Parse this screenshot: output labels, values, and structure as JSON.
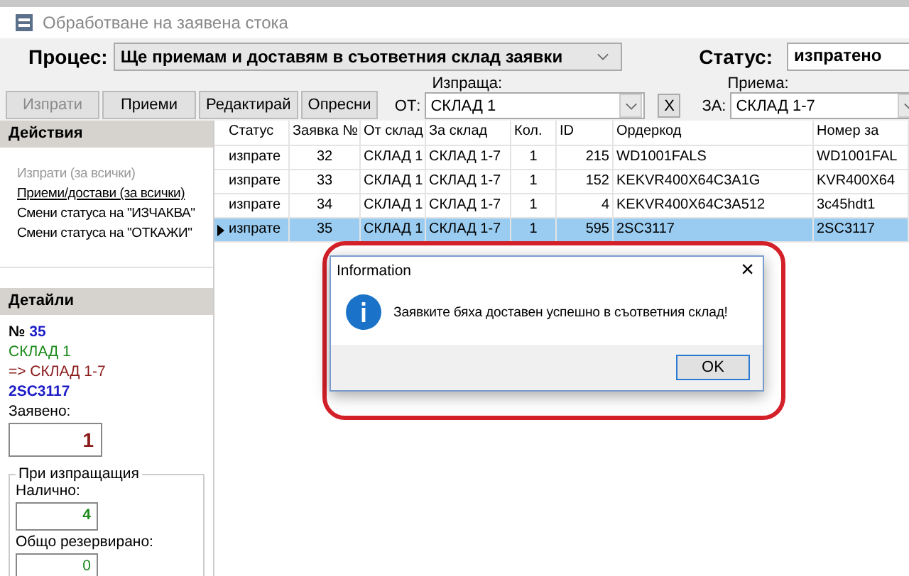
{
  "window": {
    "title": "Обработване на заявена стока"
  },
  "process": {
    "label": "Процес:",
    "value": "Ще приемам и доставям в съответния склад заявки"
  },
  "status": {
    "label": "Статус:",
    "value": "изпратено"
  },
  "toolbar": [
    {
      "label": "Изпрати",
      "disabled": true
    },
    {
      "label": "Приеми",
      "disabled": false
    },
    {
      "label": "Редактирай",
      "disabled": false
    },
    {
      "label": "Опресни",
      "disabled": false
    }
  ],
  "from": {
    "caption": "Изпраща:",
    "label": "ОТ:",
    "value": "СКЛАД 1",
    "clear": "X"
  },
  "to": {
    "caption": "Приема:",
    "label": "ЗА:",
    "value": "СКЛАД 1-7"
  },
  "actions": {
    "title": "Действия",
    "items": [
      {
        "label": "Изпрати (за всички)",
        "disabled": true,
        "underlined": false
      },
      {
        "label": "Приеми/достави (за всички)",
        "disabled": false,
        "underlined": true
      },
      {
        "label": "Смени статуса на \"ИЗЧАКВА\"",
        "disabled": false,
        "underlined": false
      },
      {
        "label": "Смени статуса на \"ОТКАЖИ\"",
        "disabled": false,
        "underlined": false
      }
    ]
  },
  "details": {
    "title": "Детайли",
    "number_label": "№",
    "number": "35",
    "from": "СКЛАД 1",
    "to": "=> СКЛАД 1-7",
    "code": "2SC3117",
    "ordered_label": "Заявено:",
    "ordered": "1",
    "group_title": "При изпращащия",
    "available_label": "Налично:",
    "available": "4",
    "reserved_label": "Общо резервирано:",
    "reserved": "0"
  },
  "table": {
    "columns": [
      "Статус",
      "Заявка №",
      "От склад",
      "За склад",
      "Кол.",
      "ID",
      "Ордеркод",
      "Номер за"
    ],
    "rows": [
      {
        "selected": false,
        "cells": [
          "изпрате",
          "32",
          "СКЛАД 1",
          "СКЛАД 1-7",
          "1",
          "215",
          "WD1001FALS",
          "WD1001FAL"
        ]
      },
      {
        "selected": false,
        "cells": [
          "изпрате",
          "33",
          "СКЛАД 1",
          "СКЛАД 1-7",
          "1",
          "152",
          "KEKVR400X64C3A1G",
          "KVR400X64"
        ]
      },
      {
        "selected": false,
        "cells": [
          "изпрате",
          "34",
          "СКЛАД 1",
          "СКЛАД 1-7",
          "1",
          "4",
          "KEKVR400X64C3A512",
          "3c45hdt1"
        ]
      },
      {
        "selected": true,
        "cells": [
          "изпрате",
          "35",
          "СКЛАД 1",
          "СКЛАД 1-7",
          "1",
          "595",
          "2SC3117",
          "2SC3117"
        ]
      }
    ]
  },
  "dialog": {
    "title": "Information",
    "close": "×",
    "message": "Заявките бяха доставен успешно в съответния склад!",
    "button": "OK",
    "highlighted": true
  }
}
